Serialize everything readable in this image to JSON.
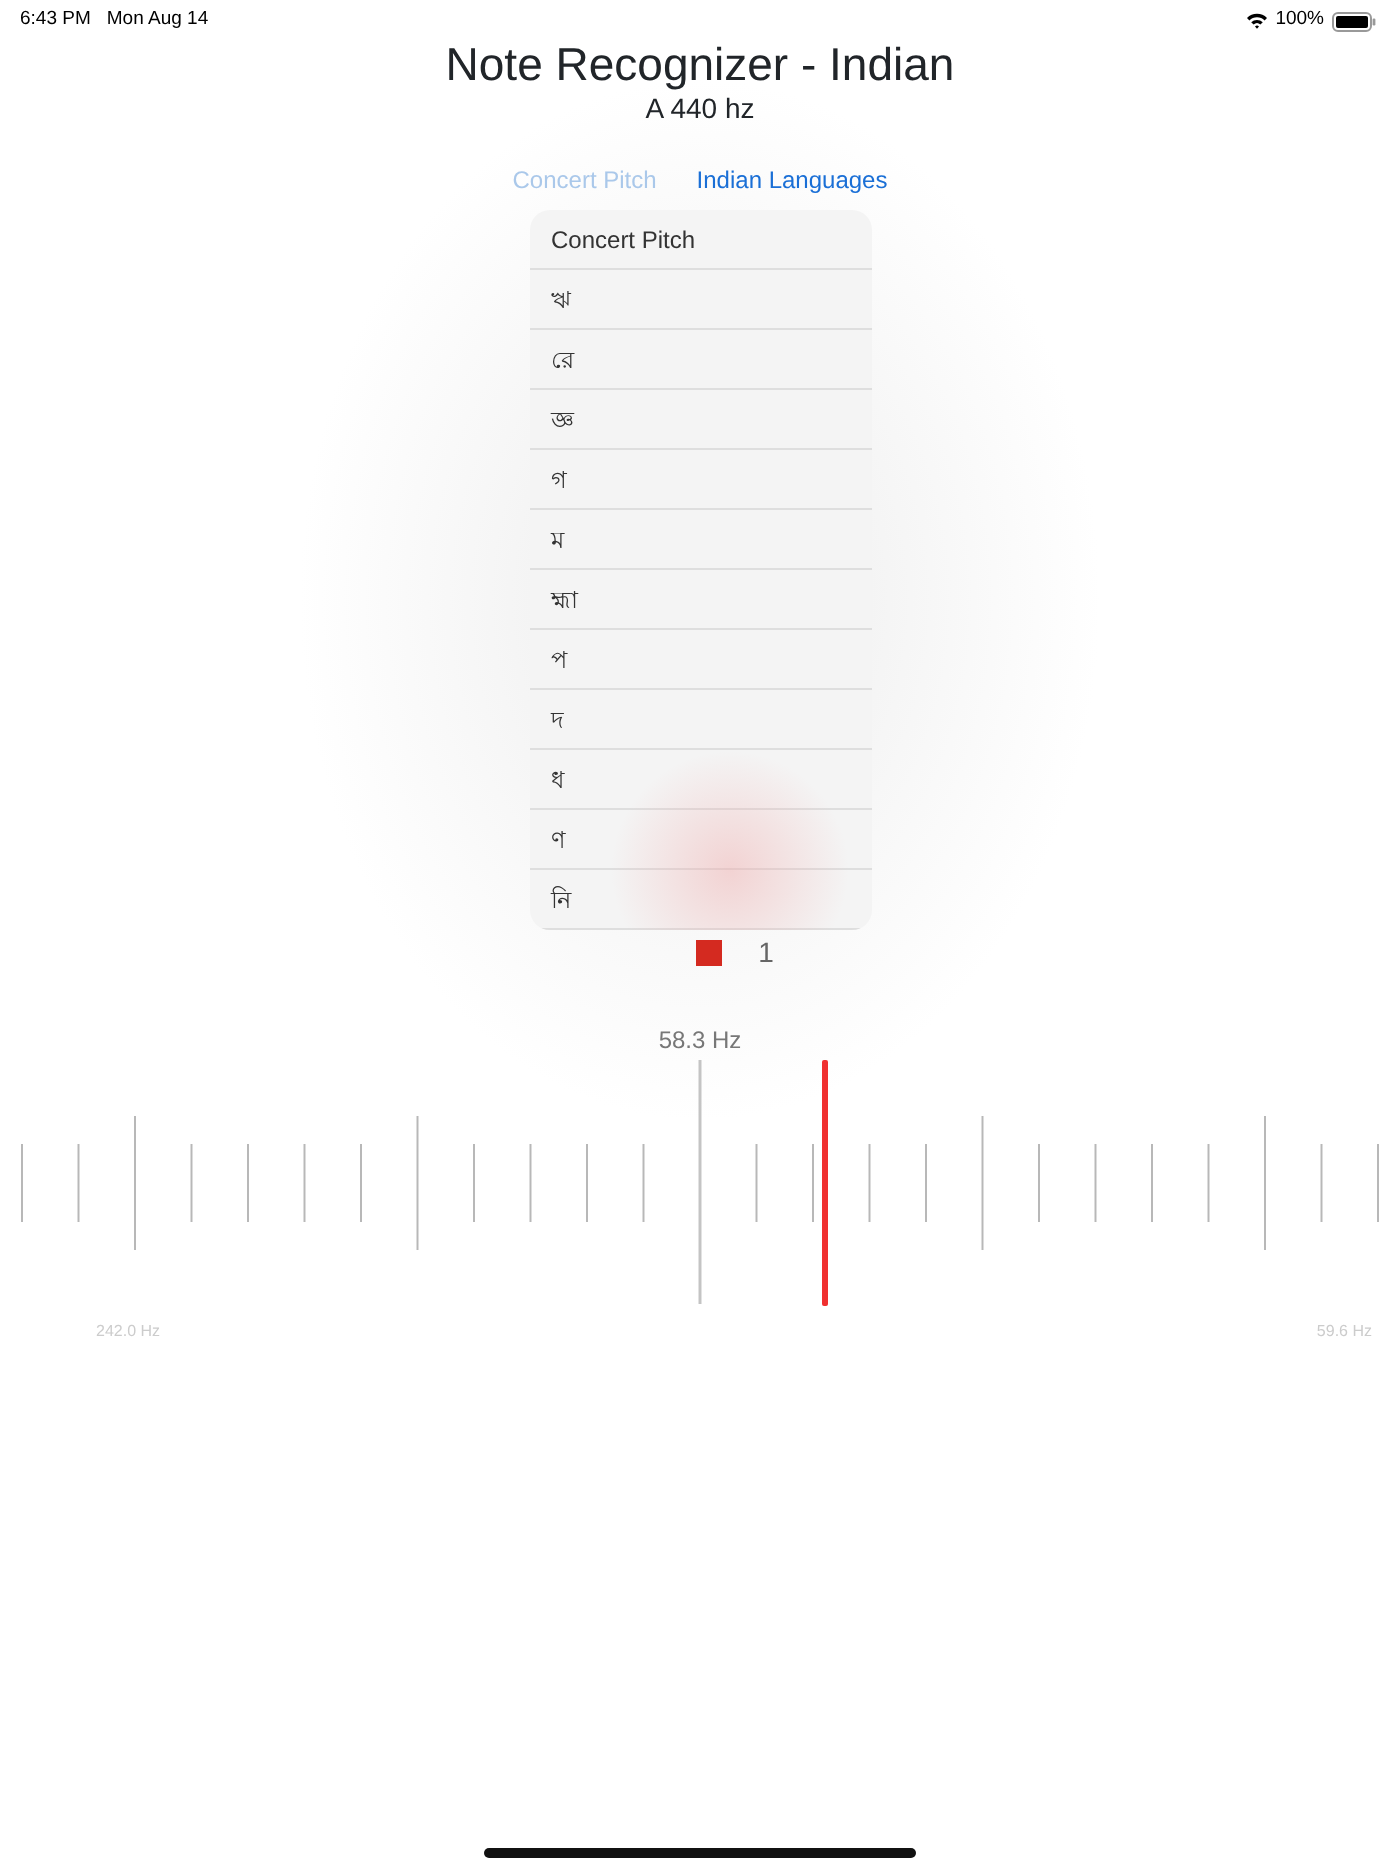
{
  "status_bar": {
    "time": "6:43 PM",
    "date": "Mon Aug 14",
    "battery": "100%"
  },
  "title": "Note Recognizer - Indian",
  "subtitle": "A 440 hz",
  "tabs": [
    {
      "label": "Concert Pitch",
      "selected": false
    },
    {
      "label": "Indian Languages",
      "selected": true
    }
  ],
  "menu": [
    {
      "label": "Concert Pitch"
    },
    {
      "label": "ঋ"
    },
    {
      "label": "রে"
    },
    {
      "label": "জ্ঞ"
    },
    {
      "label": "গ"
    },
    {
      "label": "ম"
    },
    {
      "label": "হ্মা"
    },
    {
      "label": "প"
    },
    {
      "label": "দ"
    },
    {
      "label": "ধ"
    },
    {
      "label": "ণ"
    },
    {
      "label": "নি"
    }
  ],
  "octave": {
    "color": "#d42a20",
    "label": "1"
  },
  "meter": {
    "reading": "58.3 Hz",
    "level": 0.589,
    "low_label": "242.0 Hz",
    "high_label": "59.6 Hz"
  }
}
